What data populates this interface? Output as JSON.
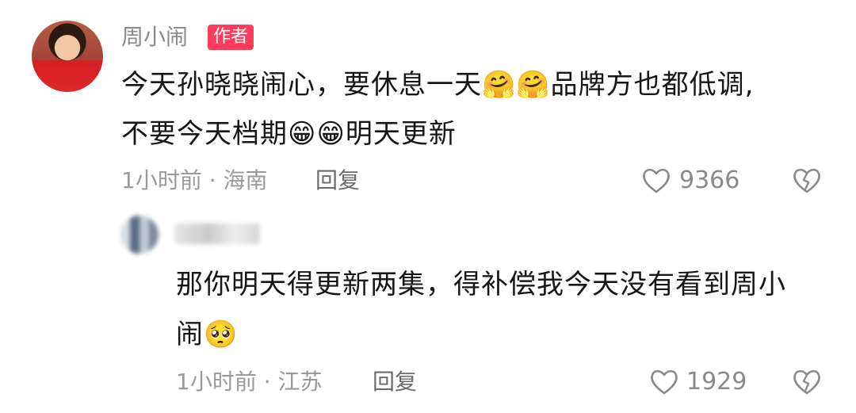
{
  "comment1": {
    "author": "周小闹",
    "badge": "作者",
    "line1": "今天孙晓晓闹心，要休息一天🤗🤗品牌方也都低调,",
    "line2": "不要今天档期😁😁明天更新",
    "time": "1小时前",
    "location": "海南",
    "sep": "·",
    "reply": "回复",
    "likes": "9366"
  },
  "comment2": {
    "line1": "那你明天得更新两集，得补偿我今天没有看到周小",
    "line2": "闹🥺",
    "time": "1小时前",
    "location": "江苏",
    "sep": "·",
    "reply": "回复",
    "likes": "1929"
  },
  "icons": {
    "like": "heart-outline-icon",
    "dislike": "broken-heart-icon"
  }
}
